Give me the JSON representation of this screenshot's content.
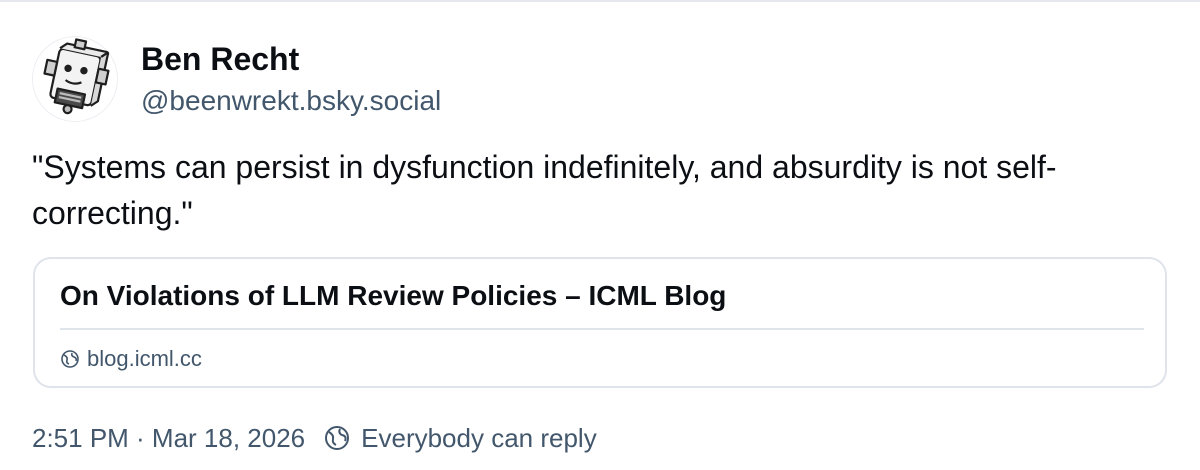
{
  "author": {
    "display_name": "Ben Recht",
    "handle": "@beenwrekt.bsky.social",
    "avatar_icon": "robot-avatar-icon"
  },
  "post": {
    "text": "\"Systems can persist in dysfunction indefinitely, and absurdity is not self-correcting.\""
  },
  "link_card": {
    "title": "On Violations of LLM Review Policies – ICML Blog",
    "domain": "blog.icml.cc",
    "domain_icon": "globe-icon"
  },
  "meta": {
    "timestamp": "2:51 PM · Mar 18, 2026",
    "reply_setting": "Everybody can reply",
    "reply_icon": "globe-icon"
  },
  "colors": {
    "text_primary": "#0b0f14",
    "text_secondary": "#42576c",
    "border": "#dfe3ea"
  }
}
